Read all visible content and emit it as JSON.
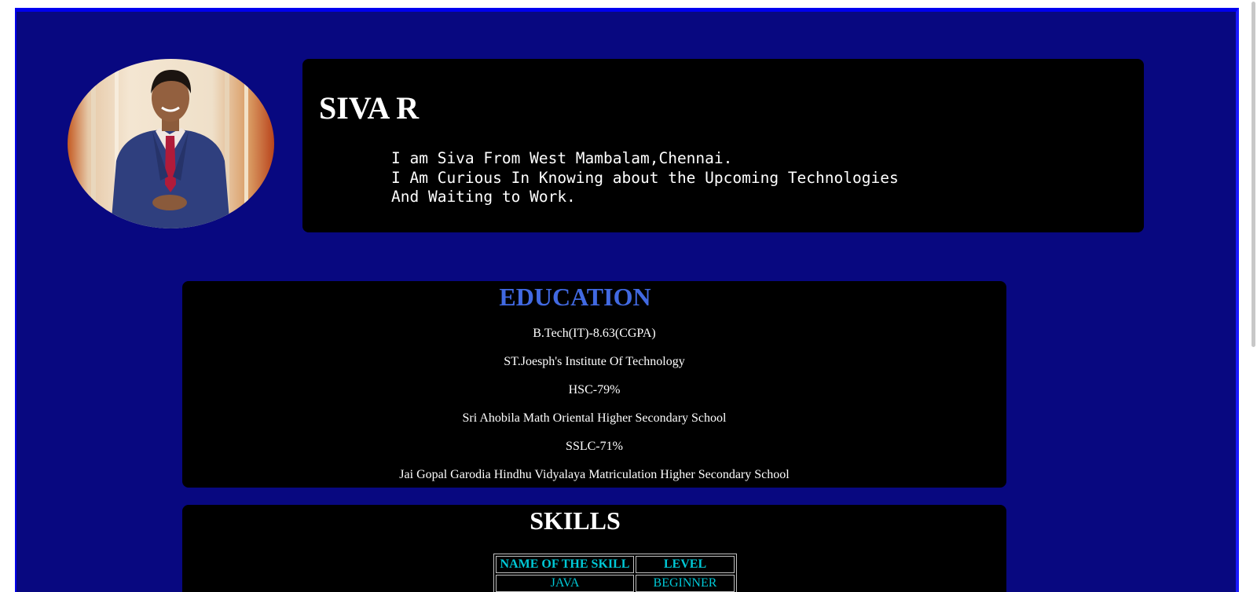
{
  "profile": {
    "name": "SIVA R",
    "intro_lines": [
      "I am Siva From West Mambalam,Chennai.",
      "I Am Curious In Knowing about the Upcoming Technologies",
      "And Waiting to Work."
    ]
  },
  "education": {
    "heading": "EDUCATION",
    "entries": [
      "B.Tech(IT)-8.63(CGPA)",
      "ST.Joesph's Institute Of Technology",
      "HSC-79%",
      "Sri Ahobila Math Oriental Higher Secondary School",
      "SSLC-71%",
      "Jai Gopal Garodia Hindhu Vidyalaya Matriculation Higher Secondary School"
    ]
  },
  "skills": {
    "heading": "SKILLS",
    "columns": [
      "NAME OF THE SKILL",
      "LEVEL"
    ],
    "rows": [
      [
        "JAVA",
        "BEGINNER"
      ]
    ]
  },
  "colors": {
    "page_background": "#080880",
    "frame_border": "#0000ee",
    "card_background": "#000000",
    "education_heading": "#4169e1",
    "table_text": "#00c8d6"
  }
}
